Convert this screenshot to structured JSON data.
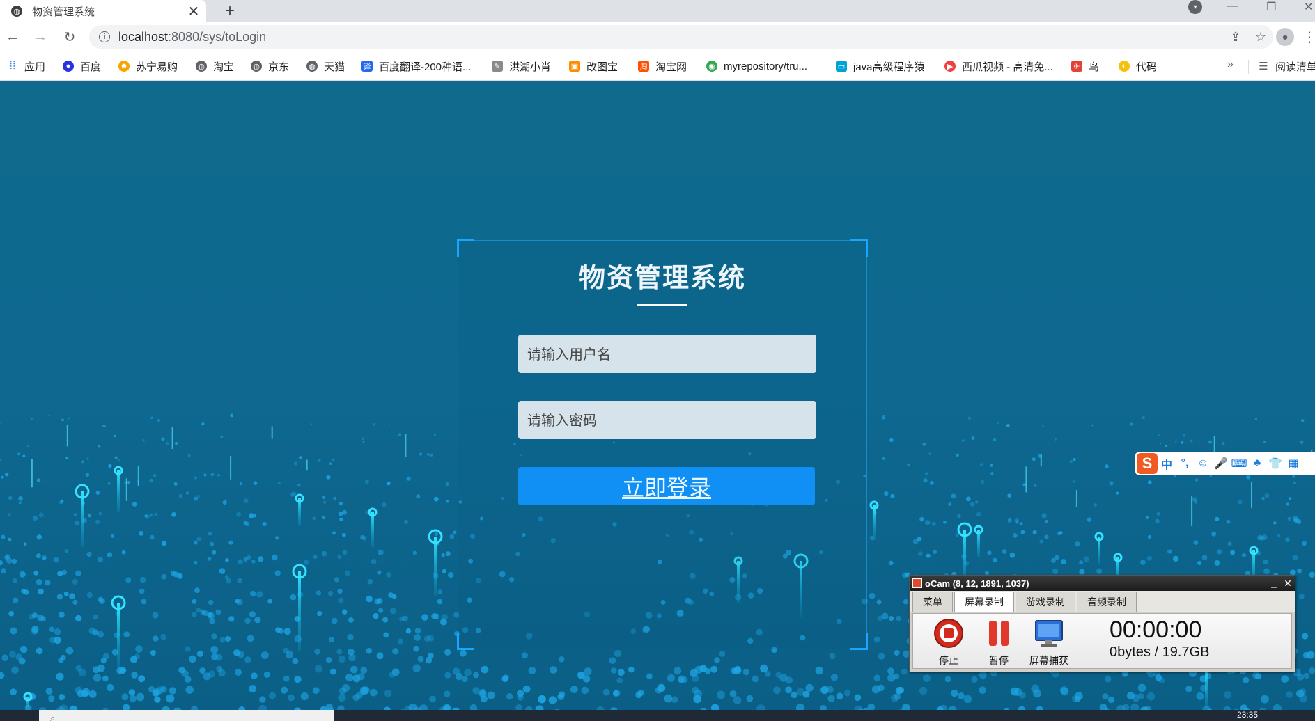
{
  "browser": {
    "tab_title": "物资管理系统",
    "tab_close": "✕",
    "new_tab": "+",
    "url_host": "localhost",
    "url_rest": ":8080/sys/toLogin"
  },
  "bookmarks": [
    {
      "label": "应用",
      "icon": "apps-grid-icon",
      "color": "#4285f4"
    },
    {
      "label": "百度",
      "icon": "baidu-paw-icon",
      "color": "#2932e1"
    },
    {
      "label": "苏宁易购",
      "icon": "suning-lion-icon",
      "color": "#f7a400"
    },
    {
      "label": "淘宝",
      "icon": "globe-icon",
      "color": "#5f6368"
    },
    {
      "label": "京东",
      "icon": "globe-icon",
      "color": "#5f6368"
    },
    {
      "label": "天猫",
      "icon": "globe-icon",
      "color": "#5f6368"
    },
    {
      "label": "百度翻译-200种语...",
      "icon": "translate-icon",
      "color": "#2468f2"
    },
    {
      "label": "洪湖小肖",
      "icon": "pen-icon",
      "color": "#8a8a8a"
    },
    {
      "label": "改图宝",
      "icon": "gaitubao-icon",
      "color": "#ff8c00"
    },
    {
      "label": "淘宝网",
      "icon": "taobao-icon",
      "color": "#ff5000"
    },
    {
      "label": "myrepository/tru...",
      "icon": "chrome-icon",
      "color": "#34a853"
    },
    {
      "label": "java高级程序猿",
      "icon": "bilibili-icon",
      "color": "#00a1d6"
    },
    {
      "label": "西瓜视频 - 高清免...",
      "icon": "xigua-icon",
      "color": "#f04142"
    },
    {
      "label": "鸟",
      "icon": "bird-icon",
      "color": "#e34234"
    },
    {
      "label": "代码",
      "icon": "bulb-icon",
      "color": "#f4c20d"
    }
  ],
  "reading_list": "阅读清单",
  "login": {
    "title": "物资管理系统",
    "username_placeholder": "请输入用户名",
    "password_placeholder": "请输入密码",
    "submit_label": "立即登录"
  },
  "ime": {
    "logo": "S",
    "items": [
      "中",
      "°,",
      "☺",
      "🎤",
      "⌨",
      "♣",
      "👕",
      "▦"
    ]
  },
  "ocam": {
    "title": "oCam (8, 12, 1891, 1037)",
    "tabs": [
      "菜单",
      "屏幕录制",
      "游戏录制",
      "音频录制"
    ],
    "active_tab": 1,
    "stop_label": "停止",
    "pause_label": "暂停",
    "capture_label": "屏幕捕获",
    "timer": "00:00:00",
    "storage": "0bytes / 19.7GB"
  },
  "taskbar": {
    "clock": "23:35"
  }
}
